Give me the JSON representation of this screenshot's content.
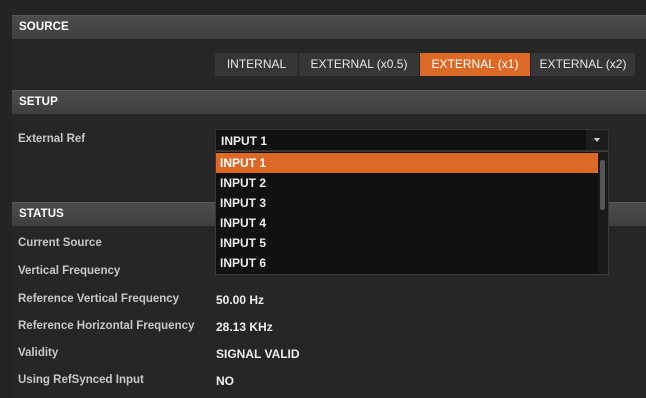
{
  "source": {
    "header": "SOURCE",
    "options": [
      "INTERNAL",
      "EXTERNAL (x0.5)",
      "EXTERNAL (x1)",
      "EXTERNAL (x2)"
    ],
    "selected": "EXTERNAL (x1)"
  },
  "setup": {
    "header": "SETUP",
    "external_ref_label": "External Ref",
    "external_ref_value": "INPUT 1",
    "dropdown_options": [
      "INPUT 1",
      "INPUT 2",
      "INPUT 3",
      "INPUT 4",
      "INPUT 5",
      "INPUT 6"
    ],
    "highlighted_option": "INPUT 1"
  },
  "status": {
    "header": "STATUS",
    "rows": [
      {
        "label": "Current Source",
        "value": ""
      },
      {
        "label": "Vertical Frequency",
        "value": ""
      },
      {
        "label": "Reference Vertical Frequency",
        "value": "50.00 Hz"
      },
      {
        "label": "Reference Horizontal Frequency",
        "value": "28.13 KHz"
      },
      {
        "label": "Validity",
        "value": "SIGNAL VALID"
      },
      {
        "label": "Using RefSynced Input",
        "value": "NO"
      }
    ]
  },
  "colors": {
    "accent": "#dc6a26",
    "background": "#242424",
    "header_bg": "#444444"
  }
}
